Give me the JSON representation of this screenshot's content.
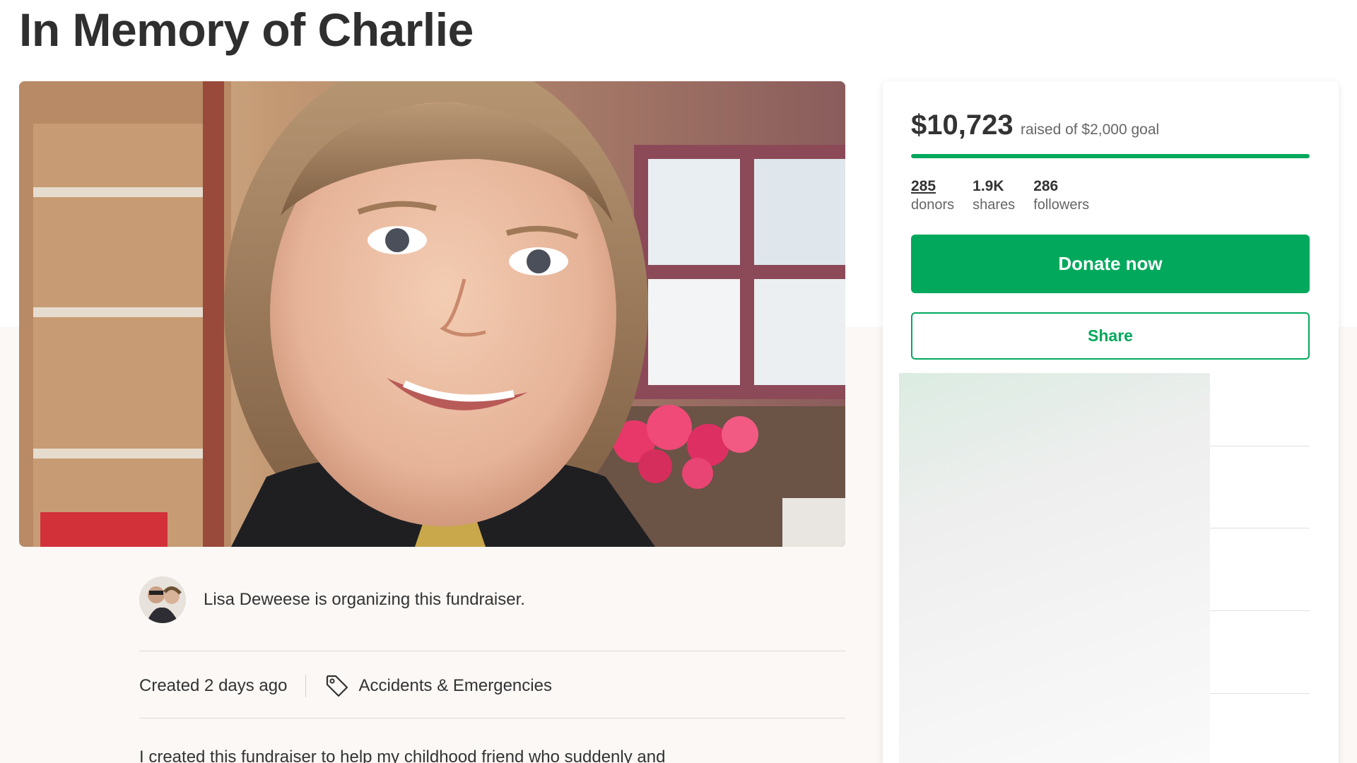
{
  "campaign": {
    "title": "In Memory of Charlie"
  },
  "organizer": {
    "text": "Lisa Deweese is organizing this fundraiser."
  },
  "meta": {
    "created": "Created 2 days ago",
    "category": "Accidents & Emergencies"
  },
  "story": {
    "first_line": "I created this fundraiser to help my childhood friend who suddenly and"
  },
  "donation": {
    "raised": "$10,723",
    "goal_text": "raised of $2,000 goal",
    "progress_fraction": 1.0,
    "stats": [
      {
        "num": "285",
        "label": "donors"
      },
      {
        "num": "1.9K",
        "label": "shares"
      },
      {
        "num": "286",
        "label": "followers"
      }
    ],
    "donate_label": "Donate now",
    "share_label": "Share"
  },
  "colors": {
    "brand_green": "#02a95c",
    "page_bg": "#fbf8f6"
  },
  "icons": {
    "category": "tag-icon"
  }
}
